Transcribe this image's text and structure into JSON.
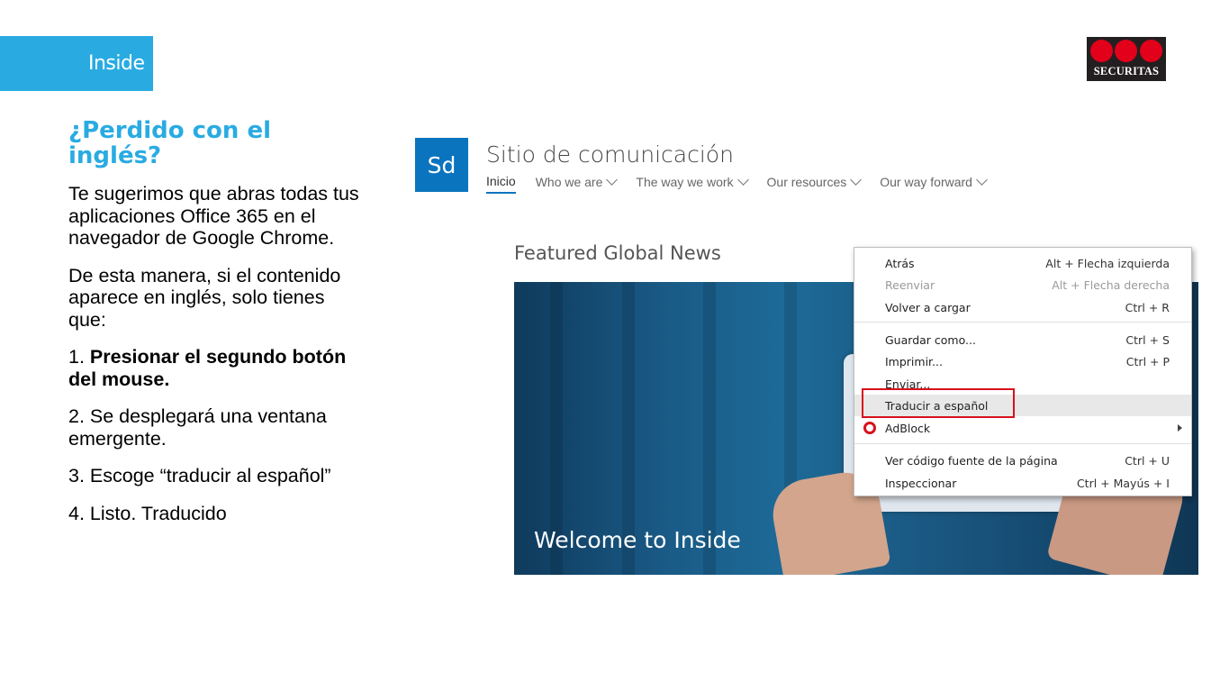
{
  "brand": {
    "tab_label": "Inside",
    "logo_text": "SECURITAS",
    "colors": {
      "accent": "#29abe2",
      "logo_red": "#e2001a",
      "logo_bg": "#231f20",
      "highlight_red": "#d7121c"
    }
  },
  "left": {
    "heading": "¿Perdido con el inglés?",
    "para1": "Te sugerimos que abras todas tus aplicaciones Office 365 en el navegador de Google Chrome.",
    "para2": "De esta manera, si el contenido aparece en inglés, solo tienes que:",
    "step1_num": "1. ",
    "step1_bold": "Presionar el segundo botón del mouse.",
    "step2": "2. Se desplegará una ventana emergente.",
    "step3": "3. Escoge “traducir al español”",
    "step4": "4. Listo. Traducido"
  },
  "site": {
    "tile": "Sd",
    "title": "Sitio de comunicación",
    "nav": [
      {
        "label": "Inicio",
        "active": true
      },
      {
        "label": "Who we are"
      },
      {
        "label": "The way we work"
      },
      {
        "label": "Our resources"
      },
      {
        "label": "Our way forward"
      }
    ],
    "section_title": "Featured Global News",
    "hero_caption": "Welcome to Inside"
  },
  "context_menu": {
    "items": [
      {
        "label": "Atrás",
        "shortcut": "Alt + Flecha izquierda"
      },
      {
        "label": "Reenviar",
        "shortcut": "Alt + Flecha derecha"
      },
      {
        "label": "Volver a cargar",
        "shortcut": "Ctrl + R"
      },
      {
        "label": "Guardar como...",
        "shortcut": "Ctrl + S"
      },
      {
        "label": "Imprimir...",
        "shortcut": "Ctrl + P"
      },
      {
        "label": "Enviar..."
      },
      {
        "label": "Traducir a español"
      },
      {
        "label": "AdBlock"
      },
      {
        "label": "Ver código fuente de la página",
        "shortcut": "Ctrl + U"
      },
      {
        "label": "Inspeccionar",
        "shortcut": "Ctrl + Mayús + I"
      }
    ]
  }
}
